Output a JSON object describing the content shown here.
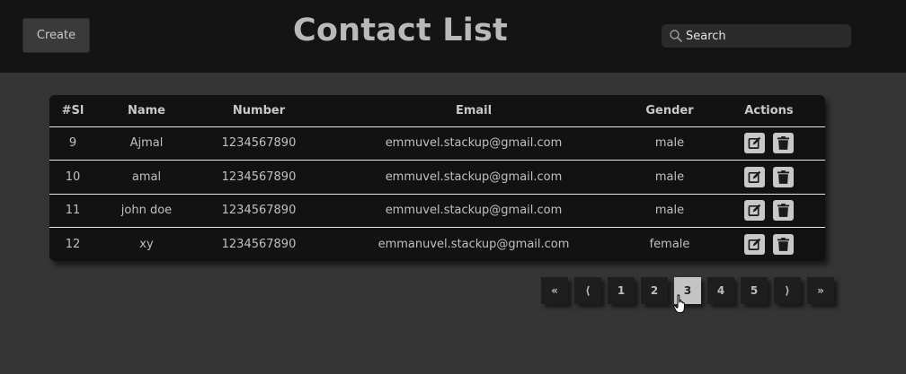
{
  "header": {
    "create_label": "Create",
    "title": "Contact List",
    "search_placeholder": "Search"
  },
  "table": {
    "columns": [
      "#Sl",
      "Name",
      "Number",
      "Email",
      "Gender",
      "Actions"
    ],
    "rows": [
      {
        "sl": "9",
        "name": "Ajmal",
        "number": "1234567890",
        "email": "emmuvel.stackup@gmail.com",
        "gender": "male"
      },
      {
        "sl": "10",
        "name": "amal",
        "number": "1234567890",
        "email": "emmuvel.stackup@gmail.com",
        "gender": "male"
      },
      {
        "sl": "11",
        "name": "john doe",
        "number": "1234567890",
        "email": "emmuvel.stackup@gmail.com",
        "gender": "male"
      },
      {
        "sl": "12",
        "name": "xy",
        "number": "1234567890",
        "email": "emmanuvel.stackup@gmail.com",
        "gender": "female"
      }
    ],
    "row_actions": [
      "edit-icon",
      "trash-icon"
    ]
  },
  "pagination": {
    "first": "«",
    "prev": "⟨",
    "pages": [
      "1",
      "2",
      "3",
      "4",
      "5"
    ],
    "current": "3",
    "next": "⟩",
    "last": "»"
  },
  "colors": {
    "background": "#353535",
    "header": "#141414",
    "table": "#121212",
    "active_page": "#c4c4c4"
  }
}
